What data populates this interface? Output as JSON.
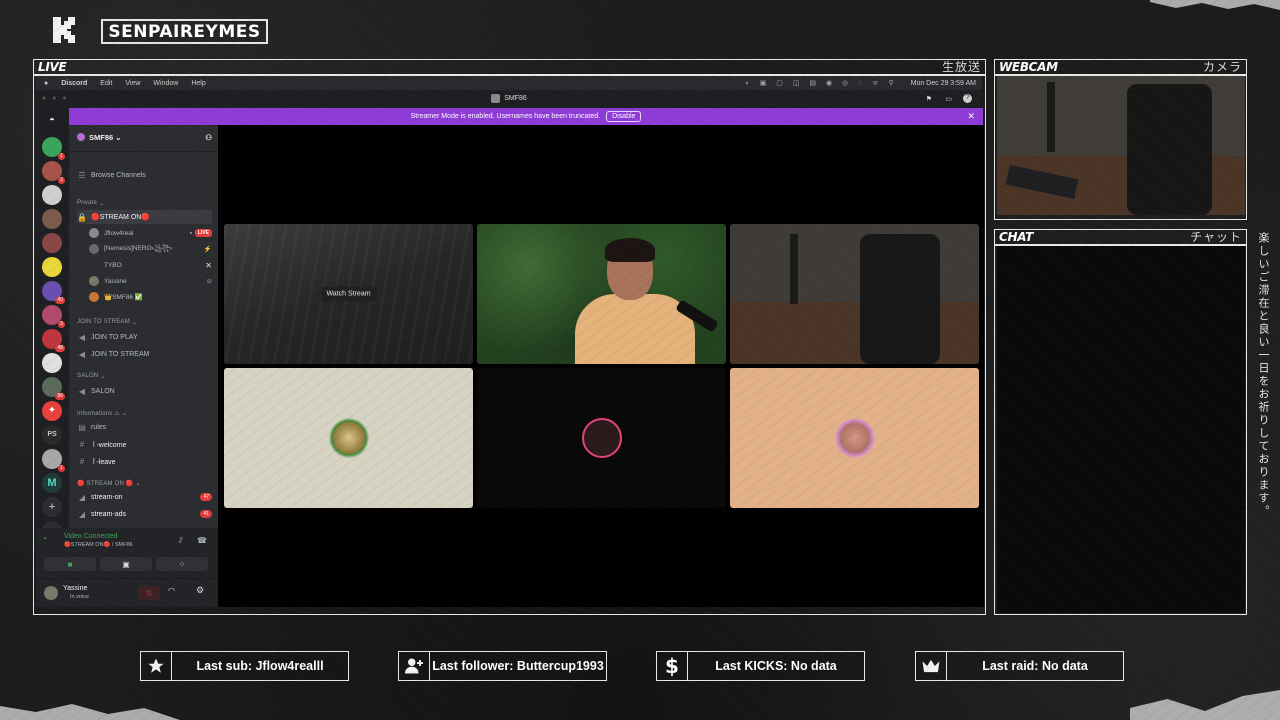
{
  "overlay": {
    "channel_name": "SENPAIREYMES",
    "panels": {
      "live": {
        "title": "LIVE",
        "jp": "生放送"
      },
      "webcam": {
        "title": "WEBCAM",
        "jp": "カメラ"
      },
      "chat": {
        "title": "CHAT",
        "jp": "チャット"
      }
    },
    "vertical_text": "楽しいご滞在と良い一日をお祈りしております。",
    "stats": [
      {
        "icon": "star-icon",
        "text": "Last sub: Jflow4realll"
      },
      {
        "icon": "user-plus-icon",
        "text": "Last follower: Buttercup1993"
      },
      {
        "icon": "dollar-icon",
        "text": "Last KICKS: No data"
      },
      {
        "icon": "crown-icon",
        "text": "Last raid: No data"
      }
    ]
  },
  "mac": {
    "menu": [
      "Discord",
      "Edit",
      "View",
      "Window",
      "Help"
    ],
    "clock": "Mon Dec 29  3:59 AM"
  },
  "discord": {
    "window_title": "SMF86",
    "streamer_banner": "Streamer Mode is enabled. Usernames have been truncated.",
    "disable_label": "Disable",
    "server_name": "SMF86",
    "browse_channels": "Browse Channels",
    "categories": {
      "private": "Private",
      "join_to_stream": "JOIN TO STREAM",
      "salon": "SALON",
      "informations": "Informations ⚠",
      "stream_on": "🔴 STREAM ON 🔴"
    },
    "voice_channel": "🔴STREAM ON🔴",
    "voice_users": [
      {
        "name": "Jflow4real",
        "live": "LIVE"
      },
      {
        "name": "[Nemesis]NERO꧁꧂"
      },
      {
        "name": "TYBO"
      },
      {
        "name": "Yassine"
      },
      {
        "name": "👑SMF86 ✅"
      }
    ],
    "channels": {
      "join_to_play": "JOIN TO PLAY",
      "join_to_stream": "JOIN TO STREAM",
      "salon": "SALON",
      "rules": "rules",
      "welcome": "꒰‐welcome",
      "leave": "꒰‐leave",
      "stream_on": "stream-on",
      "stream_on_count": "47",
      "stream_ads": "stream-ads",
      "stream_ads_count": "41"
    },
    "voice_status": {
      "title": "Video Connected",
      "subtitle": "🔴STREAM ON🔴 / SMF86"
    },
    "me": {
      "name": "Yassine",
      "status": "In voice"
    },
    "watch_stream": "Watch Stream",
    "server_badges": [
      "1",
      "2",
      "",
      "",
      "",
      "",
      "",
      "",
      "40",
      "5",
      "",
      "48",
      "96",
      "",
      "",
      "",
      "1"
    ]
  }
}
